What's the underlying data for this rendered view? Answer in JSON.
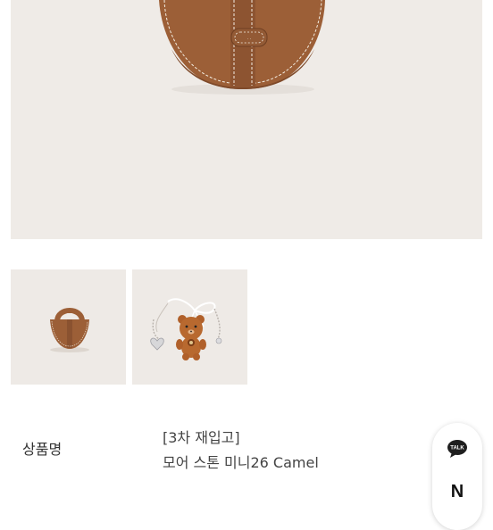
{
  "product": {
    "name_label": "상품명",
    "name_line1": "[3차 재입고]",
    "name_line2": "모어 스톤 미니26 Camel"
  },
  "floating_buttons": {
    "talk_label": "TALK",
    "naver_label": "N"
  },
  "colors": {
    "camel": "#9c5f37",
    "stitch": "#f3ede2",
    "image_bg": "#efebe7"
  }
}
